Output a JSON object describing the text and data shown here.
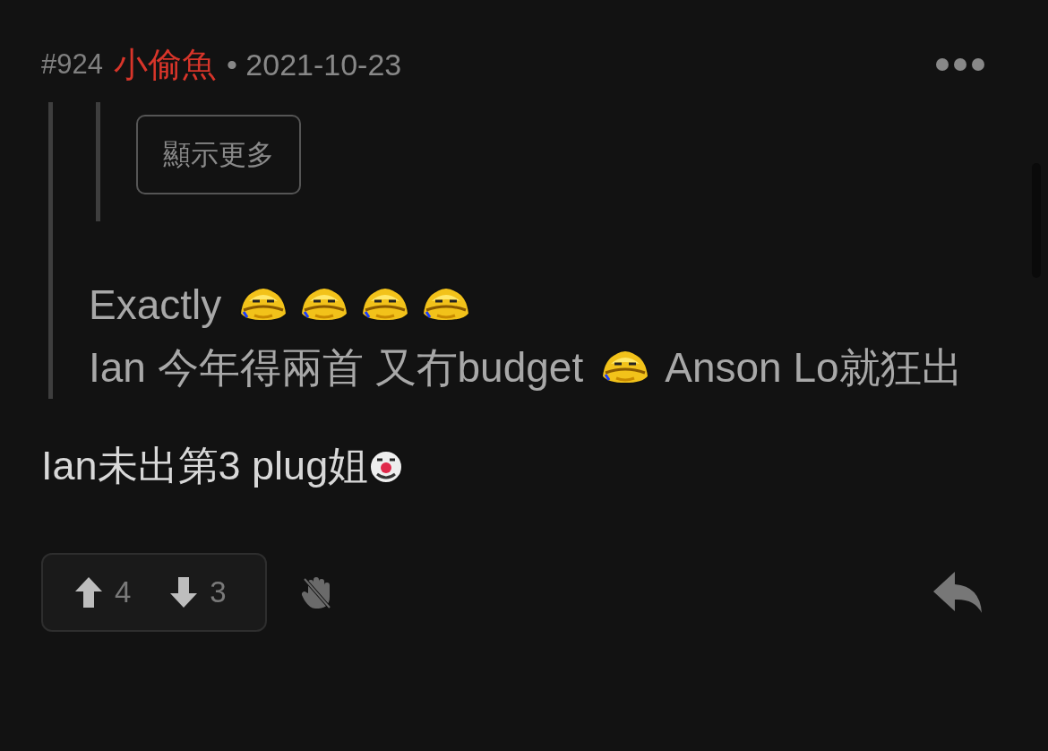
{
  "post": {
    "number": "#924",
    "author": "小偷魚",
    "date": "• 2021-10-23"
  },
  "quote": {
    "nested_button": "顯示更多",
    "paragraphs": [
      [
        {
          "kind": "text",
          "text": "Exactly "
        },
        {
          "kind": "laugh"
        },
        {
          "kind": "laugh"
        },
        {
          "kind": "laugh"
        },
        {
          "kind": "laugh"
        }
      ],
      [
        {
          "kind": "text",
          "text": "Ian 今年得兩首 又冇budget "
        },
        {
          "kind": "laugh"
        },
        {
          "kind": "text",
          "text": " Anson Lo就狂出"
        }
      ]
    ]
  },
  "body": [
    {
      "kind": "text",
      "text": "Ian未出第3 plug姐"
    },
    {
      "kind": "clown"
    }
  ],
  "votes": {
    "up": "4",
    "down": "3"
  }
}
